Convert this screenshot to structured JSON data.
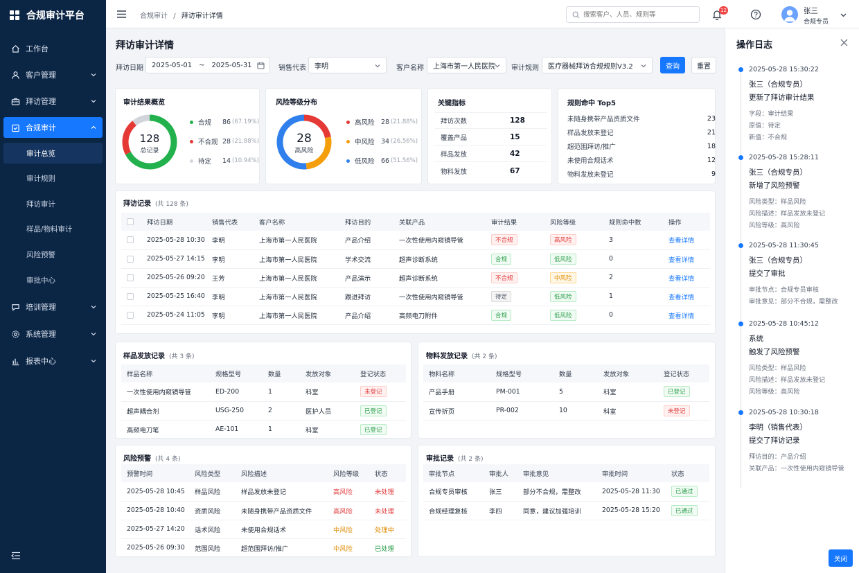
{
  "app": {
    "title": "合规审计平台"
  },
  "nav": [
    {
      "label": "工作台"
    },
    {
      "label": "客户管理"
    },
    {
      "label": "拜访管理"
    },
    {
      "label": "合规审计"
    },
    {
      "label": "培训管理"
    },
    {
      "label": "系统管理"
    },
    {
      "label": "报表中心"
    }
  ],
  "subnav": [
    {
      "label": "审计总览"
    },
    {
      "label": "审计规则"
    },
    {
      "label": "拜访审计"
    },
    {
      "label": "样品/物料审计"
    },
    {
      "label": "风险预警"
    },
    {
      "label": "审批中心"
    }
  ],
  "breadcrumb": {
    "parent": "合规审计",
    "sep": "/",
    "current": "拜访审计详情"
  },
  "search": {
    "placeholder": "搜索客户、人员、规则等"
  },
  "notifications": {
    "count": "12"
  },
  "user": {
    "name": "张三",
    "role": "合规专员"
  },
  "page": {
    "title": "拜访审计详情"
  },
  "filters": {
    "date_label": "拜访日期",
    "date_start": "2025-05-01",
    "date_sep": "~",
    "date_end": "2025-05-31",
    "rep_label": "销售代表",
    "rep_value": "李明",
    "customer_label": "客户名称",
    "customer_value": "上海市第一人民医院",
    "rule_label": "审计规则",
    "rule_value": "医疗器械拜访合规规则V3.2",
    "query_button": "查询",
    "reset_button": "重置"
  },
  "overview": {
    "title": "审计结果概览",
    "total": "128",
    "total_label": "总记录",
    "items": [
      {
        "label": "合规",
        "value": "86",
        "pct": "(67.19%)",
        "color": "#22b14c",
        "frac": 0.6719
      },
      {
        "label": "不合规",
        "value": "28",
        "pct": "(21.88%)",
        "color": "#e53935",
        "frac": 0.2188
      },
      {
        "label": "待定",
        "value": "14",
        "pct": "(10.94%)",
        "color": "#d1d5db",
        "frac": 0.1094
      }
    ]
  },
  "risk": {
    "title": "风险等级分布",
    "total": "28",
    "total_label": "高风险",
    "items": [
      {
        "label": "高风险",
        "value": "28",
        "pct": "(21.88%)",
        "color": "#e53935",
        "frac": 0.2188
      },
      {
        "label": "中风险",
        "value": "34",
        "pct": "(26.56%)",
        "color": "#f59e0b",
        "frac": 0.2656
      },
      {
        "label": "低风险",
        "value": "66",
        "pct": "(51.56%)",
        "color": "#2f80ed",
        "frac": 0.5156
      }
    ]
  },
  "kpi": {
    "title": "关键指标",
    "items": [
      {
        "label": "拜访次数",
        "value": "128"
      },
      {
        "label": "覆盖产品",
        "value": "15"
      },
      {
        "label": "样品发放",
        "value": "42"
      },
      {
        "label": "物料发放",
        "value": "67"
      }
    ]
  },
  "rules": {
    "title": "规则命中 Top5",
    "items": [
      {
        "label": "未随身携带产品资质文件",
        "value": "23"
      },
      {
        "label": "样品发放未登记",
        "value": "21"
      },
      {
        "label": "超范围拜访/推广",
        "value": "18"
      },
      {
        "label": "未使用合规话术",
        "value": "12"
      },
      {
        "label": "物料发放未登记",
        "value": "9"
      }
    ]
  },
  "visits": {
    "title": "拜访记录",
    "count": "(共 128 条)",
    "headers": [
      "拜访日期",
      "销售代表",
      "客户名称",
      "拜访目的",
      "关联产品",
      "审计结果",
      "风险等级",
      "规则命中数",
      "操作"
    ],
    "rows": [
      {
        "date": "2025-05-28 10:30",
        "rep": "李明",
        "customer": "上海市第一人民医院",
        "purpose": "产品介绍",
        "product": "一次性使用内窥镜导管",
        "result": "不合规",
        "result_color": "red",
        "risk": "高风险",
        "risk_color": "red",
        "hits": "3",
        "action": "查看详情"
      },
      {
        "date": "2025-05-27 14:15",
        "rep": "李明",
        "customer": "上海市第一人民医院",
        "purpose": "学术交流",
        "product": "超声诊断系统",
        "result": "合规",
        "result_color": "green",
        "risk": "低风险",
        "risk_color": "green",
        "hits": "0",
        "action": "查看详情"
      },
      {
        "date": "2025-05-26 09:20",
        "rep": "王芳",
        "customer": "上海市第一人民医院",
        "purpose": "产品演示",
        "product": "超声诊断系统",
        "result": "不合规",
        "result_color": "red",
        "risk": "中风险",
        "risk_color": "orange",
        "hits": "2",
        "action": "查看详情"
      },
      {
        "date": "2025-05-25 16:40",
        "rep": "李明",
        "customer": "上海市第一人民医院",
        "purpose": "跟进拜访",
        "product": "一次性使用内窥镜导管",
        "result": "待定",
        "result_color": "gray",
        "risk": "低风险",
        "risk_color": "green",
        "hits": "1",
        "action": "查看详情"
      },
      {
        "date": "2025-05-24 11:05",
        "rep": "李明",
        "customer": "上海市第一人民医院",
        "purpose": "产品介绍",
        "product": "高频电刀附件",
        "result": "合规",
        "result_color": "green",
        "risk": "低风险",
        "risk_color": "green",
        "hits": "0",
        "action": "查看详情"
      }
    ]
  },
  "samples": {
    "title": "样品发放记录",
    "count": "(共 3 条)",
    "headers": [
      "样品名称",
      "规格型号",
      "数量",
      "发放对象",
      "登记状态"
    ],
    "rows": [
      {
        "name": "一次性使用内窥镜导管",
        "spec": "ED-200",
        "qty": "1",
        "target": "科室",
        "status": "未登记",
        "status_color": "red"
      },
      {
        "name": "超声耦合剂",
        "spec": "USG-250",
        "qty": "2",
        "target": "医护人员",
        "status": "已登记",
        "status_color": "green"
      },
      {
        "name": "高频电刀笔",
        "spec": "AE-101",
        "qty": "1",
        "target": "科室",
        "status": "已登记",
        "status_color": "green"
      }
    ]
  },
  "materials": {
    "title": "物料发放记录",
    "count": "(共 2 条)",
    "headers": [
      "物料名称",
      "规格型号",
      "数量",
      "发放对象",
      "登记状态"
    ],
    "rows": [
      {
        "name": "产品手册",
        "spec": "PM-001",
        "qty": "5",
        "target": "科室",
        "status": "已登记",
        "status_color": "green"
      },
      {
        "name": "宣传折页",
        "spec": "PR-002",
        "qty": "10",
        "target": "科室",
        "status": "未登记",
        "status_color": "red"
      }
    ]
  },
  "alerts": {
    "title": "风险预警",
    "count": "(共 4 条)",
    "headers": [
      "预警时间",
      "风险类型",
      "风险描述",
      "风险等级",
      "状态"
    ],
    "rows": [
      {
        "time": "2025-05-28 10:45",
        "type": "样品风险",
        "desc": "样品发放未登记",
        "level": "高风险",
        "level_color": "red",
        "status": "未处理",
        "status_color": "red"
      },
      {
        "time": "2025-05-28 10:40",
        "type": "资质风险",
        "desc": "未随身携带产品资质文件",
        "level": "高风险",
        "level_color": "red",
        "status": "未处理",
        "status_color": "red"
      },
      {
        "time": "2025-05-27 14:20",
        "type": "话术风险",
        "desc": "未使用合规话术",
        "level": "中风险",
        "level_color": "orange",
        "status": "处理中",
        "status_color": "orange"
      },
      {
        "time": "2025-05-26 09:30",
        "type": "范围风险",
        "desc": "超范围拜访/推广",
        "level": "中风险",
        "level_color": "orange",
        "status": "已处理",
        "status_color": "green"
      }
    ]
  },
  "approvals": {
    "title": "审批记录",
    "count": "(共 2 条)",
    "headers": [
      "审批节点",
      "审批人",
      "审批意见",
      "审批时间",
      "状态"
    ],
    "rows": [
      {
        "node": "合规专员审核",
        "person": "张三",
        "opinion": "部分不合规，需整改",
        "time": "2025-05-28 11:30",
        "status": "已通过",
        "status_color": "green"
      },
      {
        "node": "合规经理复核",
        "person": "李四",
        "opinion": "同意，建议加强培训",
        "time": "2025-05-28 15:20",
        "status": "已通过",
        "status_color": "green"
      }
    ]
  },
  "log": {
    "title": "操作日志",
    "close_button": "关闭",
    "entries": [
      {
        "time": "2025-05-28 15:30:22",
        "user": "张三（合规专员）",
        "action": "更新了拜访审计结果",
        "details": [
          "字段：审计结果",
          "原值：待定",
          "新值：不合规"
        ]
      },
      {
        "time": "2025-05-28 15:28:11",
        "user": "张三（合规专员）",
        "action": "新增了风险预警",
        "details": [
          "风险类型：样品风险",
          "风险描述：样品发放未登记",
          "风险等级：高风险"
        ]
      },
      {
        "time": "2025-05-28 11:30:45",
        "user": "张三（合规专员）",
        "action": "提交了审批",
        "details": [
          "审批节点：合规专员审核",
          "审批意见：部分不合规，需整改"
        ]
      },
      {
        "time": "2025-05-28 10:45:12",
        "user": "系统",
        "action": "触发了风险预警",
        "details": [
          "风险类型：样品风险",
          "风险描述：样品发放未登记",
          "风险等级：高风险"
        ]
      },
      {
        "time": "2025-05-28 10:30:18",
        "user": "李明（销售代表）",
        "action": "提交了拜访记录",
        "details": [
          "拜访目的：产品介绍",
          "关联产品：一次性使用内窥镜导管"
        ]
      }
    ]
  }
}
